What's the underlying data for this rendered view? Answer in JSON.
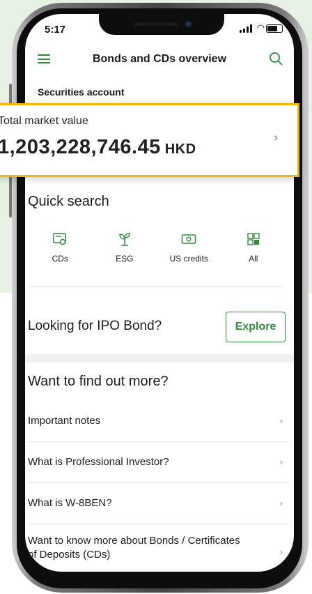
{
  "status_bar": {
    "time": "5:17"
  },
  "nav": {
    "title": "Bonds and CDs overview"
  },
  "account": {
    "label": "Securities account"
  },
  "market_value": {
    "label": "Total market value",
    "amount": "1,203,228,746.45",
    "currency": "HKD"
  },
  "quick_search": {
    "title": "Quick search",
    "items": [
      {
        "label": "CDs",
        "icon": "certificate-icon"
      },
      {
        "label": "ESG",
        "icon": "plant-icon"
      },
      {
        "label": "US credits",
        "icon": "banknote-icon"
      },
      {
        "label": "All",
        "icon": "grid-icon"
      }
    ]
  },
  "ipo": {
    "text": "Looking for IPO Bond?",
    "button": "Explore"
  },
  "more": {
    "title": "Want to find out more?",
    "items": [
      "Important notes",
      "What is Professional Investor?",
      "What is W-8BEN?",
      "Want to know more about Bonds / Certificates of Deposits (CDs)"
    ]
  },
  "colors": {
    "accent": "#2e8b3a",
    "highlight": "#f2b705",
    "background": "#e6f3e2"
  }
}
